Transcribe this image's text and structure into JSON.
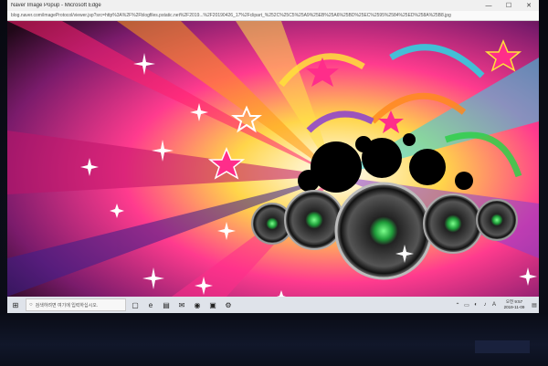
{
  "window": {
    "title": "Naver Image Popup - Microsoft Edge",
    "controls": {
      "minimize": "—",
      "maximize": "☐",
      "close": "✕"
    }
  },
  "address": {
    "url": "blog.naver.com/imageProtocol/viewer.jsp?src=http%3A%2F%2Fblogfiles.pstatic.net%2F2019...%2F20190426_17%2Fclipart_%252C%25C5%25A9%25EB%25A6%25BD%25EC%2595%2584%25ED%258A%25B8.jpg"
  },
  "taskbar": {
    "start_glyph": "⊞",
    "search_placeholder": "검색하려면 여기에 입력하십시오.",
    "search_glyph": "○",
    "apps": [
      {
        "glyph": "▢"
      },
      {
        "glyph": "e"
      },
      {
        "glyph": "▤"
      },
      {
        "glyph": "✉"
      },
      {
        "glyph": "◉"
      },
      {
        "glyph": "▣"
      },
      {
        "glyph": "⚙"
      }
    ],
    "tray": [
      {
        "glyph": "⌃"
      },
      {
        "glyph": "▭"
      },
      {
        "glyph": "◐"
      },
      {
        "glyph": "♪"
      },
      {
        "glyph": "A"
      }
    ],
    "time": "오전 9:57",
    "date": "2019-11-09",
    "notification_glyph": "▤"
  },
  "artwork": {
    "stars": "white-sparkle-icon",
    "speakers": "speaker-cone-icon",
    "colors": {
      "pink": "#ff2d8a",
      "yellow": "#ffe23a",
      "cyan": "#2ad7e5",
      "orange": "#ff8a1f",
      "purple": "#8a3fd1",
      "green": "#2fd04a"
    }
  }
}
